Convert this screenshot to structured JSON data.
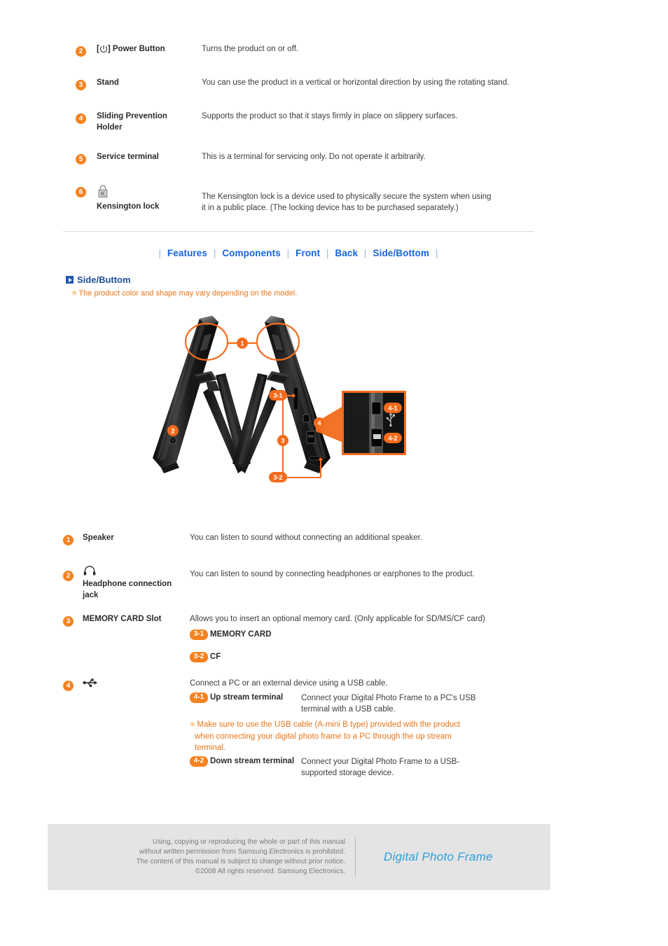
{
  "top_spec": {
    "rows": [
      {
        "num": "2",
        "icon": "power-icon",
        "name_prefix": "[",
        "name_suffix": "] Power Button",
        "name": "[⏻] Power Button",
        "desc": "Turns the product on or off."
      },
      {
        "num": "3",
        "icon": "",
        "name": "Stand",
        "desc": "You can use the product in a vertical or horizontal direction by using the rotating stand."
      },
      {
        "num": "4",
        "icon": "",
        "name": "Sliding Prevention Holder",
        "desc": "Supports the product so that it stays firmly in place on slippery surfaces."
      },
      {
        "num": "5",
        "icon": "",
        "name": "Service terminal",
        "desc": "This is a terminal for servicing only. Do not operate it arbitrarily."
      },
      {
        "num": "6",
        "icon": "kensington-lock-icon",
        "name": "Kensington lock",
        "desc": "The Kensington lock is a device used to physically secure the system when using it in a public place. (The locking device has to be purchased separately.)"
      }
    ]
  },
  "nav": {
    "separator": "|",
    "links": [
      {
        "label": "Features"
      },
      {
        "label": "Components"
      },
      {
        "label": "Front"
      },
      {
        "label": "Back"
      },
      {
        "label": "Side/Bottom"
      }
    ]
  },
  "section": {
    "title": "Side/Buttom",
    "note_mark": "※",
    "note": "The product color and shape may vary depending on the model."
  },
  "diagram": {
    "callouts": [
      "1",
      "2",
      "3",
      "3-1",
      "3-2",
      "4",
      "4-1",
      "4-2"
    ],
    "usb_symbol": "usb-icon"
  },
  "bottom_spec": {
    "rows": [
      {
        "num": "1",
        "icon": "",
        "name": "Speaker",
        "desc": "You can listen to sound without connecting an additional speaker."
      },
      {
        "num": "2",
        "icon": "headphone-icon",
        "name": "Headphone connection jack",
        "desc": "You can listen to sound by connecting headphones or earphones to the product."
      },
      {
        "num": "3",
        "icon": "",
        "name": "MEMORY CARD Slot",
        "desc": "Allows you to insert an optional memory card. (Only applicable for SD/MS/CF card)",
        "subs": [
          {
            "pill": "3-1",
            "label": "MEMORY CARD",
            "desc": ""
          },
          {
            "pill": "3-2",
            "label": "CF",
            "desc": ""
          }
        ]
      },
      {
        "num": "4",
        "icon": "usb-icon",
        "name": "",
        "desc": "Connect a PC or an external device using a USB cable.",
        "subs": [
          {
            "pill": "4-1",
            "label": "Up stream terminal",
            "desc": "Connect your Digital Photo Frame to a PC's USB terminal with a USB cable."
          }
        ],
        "note_mark": "※",
        "note": "Make sure to use the USB cable (A-mini B type) provided with the product when connecting your digital photo frame to a PC through the up stream terminal.",
        "subs2": [
          {
            "pill": "4-2",
            "label": "Down stream terminal",
            "desc": "Connect your Digital Photo Frame to a USB-supported storage device."
          }
        ]
      }
    ]
  },
  "footer": {
    "line1": "Using, copying or reproducing the whole or part of this manual",
    "line2": "without written permission from Samsung Electronics  is prohibited.",
    "line3": "The content of this manual is subject to change without prior notice.",
    "line4": "©2008 All rights reserved. Samsung Electronics.",
    "logo": "Digital Photo Frame"
  },
  "colors": {
    "accent_orange": "#f58220",
    "link_blue": "#1464e0",
    "heading_blue": "#1f4e9c",
    "logo_blue": "#2c9fd9",
    "note_orange": "#e8761a",
    "footer_bg": "#e4e4e4"
  }
}
